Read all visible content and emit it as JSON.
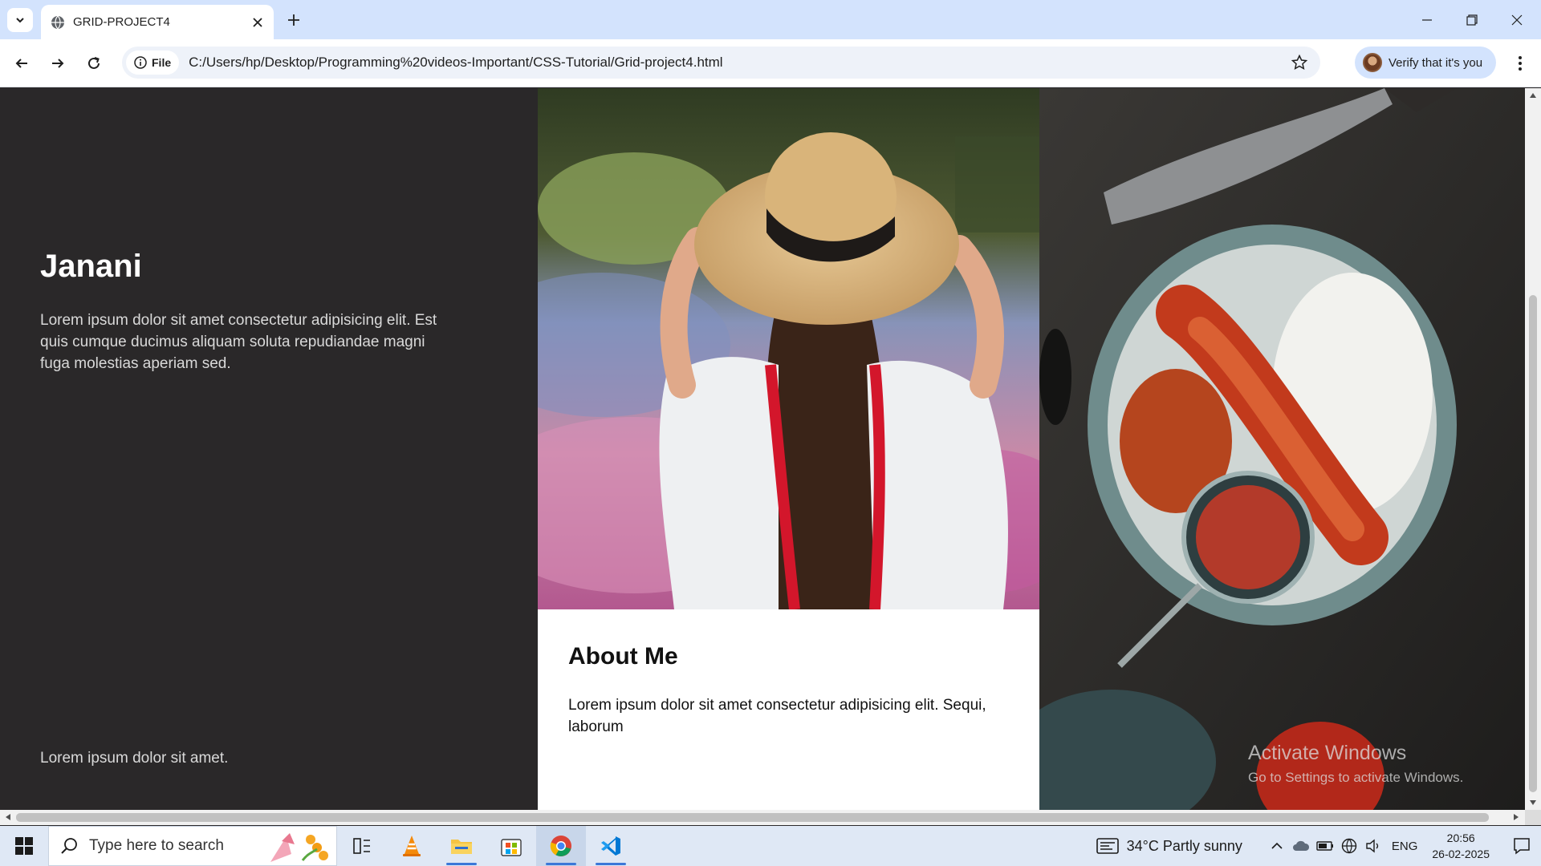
{
  "browser": {
    "tab_title": "GRID-PROJECT4",
    "site_chip_label": "File",
    "url": "C:/Users/hp/Desktop/Programming%20videos-Important/CSS-Tutorial/Grid-project4.html",
    "verify_label": "Verify that it's you"
  },
  "page": {
    "name": "Janani",
    "intro": "Lorem ipsum dolor sit amet consectetur adipisicing elit. Est quis cumque ducimus aliquam soluta repudiandae magni fuga molestias aperiam sed.",
    "footer_text": "Lorem ipsum dolor sit amet.",
    "about_title": "About Me",
    "about_text": "Lorem ipsum dolor sit amet consectetur adipisicing elit. Sequi, laborum"
  },
  "watermark": {
    "line1": "Activate Windows",
    "line2": "Go to Settings to activate Windows."
  },
  "taskbar": {
    "search_placeholder": "Type here to search",
    "weather": "34°C  Partly sunny",
    "language": "ENG",
    "time": "20:56",
    "date": "26-02-2025"
  },
  "colors": {
    "tab_strip": "#d3e3fd",
    "page_dark": "#2a2829",
    "about_bg": "#ffffff",
    "taskbar": "#dfe8f5"
  }
}
